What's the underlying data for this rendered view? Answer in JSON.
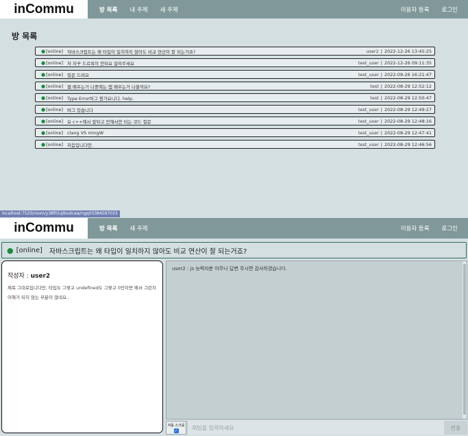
{
  "nav1": {
    "logo": "inCommu",
    "left_links": [
      "방 목록",
      "내 주제",
      "새 주제"
    ],
    "right_links": [
      "이용자 등록",
      "로그인"
    ]
  },
  "room_list": {
    "title": "방 목록",
    "rooms": [
      {
        "status": "[online]",
        "title": "자바스크립트는 왜 타입이 일치하지 않아도 비교 연산이 잘 되는거죠?",
        "author": "user2",
        "time": "2022-12-26 13:45:25"
      },
      {
        "status": "[online]",
        "title": "저 자꾸 드르륵이 안되요 알려주세요",
        "author": "test_user",
        "time": "2022-12-26 09:11:35"
      },
      {
        "status": "[online]",
        "title": "질문 드려요",
        "author": "test_user",
        "time": "2022-09-26 16:21:47"
      },
      {
        "status": "[online]",
        "title": "웹 배우는거 나중에는 앱 배우는거 나올까요?",
        "author": "test",
        "time": "2022-08-29 12:52:12"
      },
      {
        "status": "[online]",
        "title": "Type Error버그 뭔가요니다. help.",
        "author": "test",
        "time": "2022-08-29 12:50:47"
      },
      {
        "status": "[online]",
        "title": "버그 있습니다",
        "author": "test_user",
        "time": "2022-08-29 12:49:27"
      },
      {
        "status": "[online]",
        "title": "요 c++에서 앞뒤고 안해서만 되는 코드 질문",
        "author": "test_user",
        "time": "2022-08-29 12:48:16"
      },
      {
        "status": "[online]",
        "title": "clang VS mingW",
        "author": "test_user",
        "time": "2022-08-29 12:47:41"
      },
      {
        "status": "[online]",
        "title": "처음입니다만.",
        "author": "test_user",
        "time": "2022-08-29 12:46:56"
      }
    ]
  },
  "status_url": "localhost:7520/room/y38f01qlbxdcaw/ngq03384567033",
  "nav2": {
    "logo": "inCommu",
    "left_links": [
      "방 목록",
      "새 주제"
    ],
    "right_links": [
      "이용자 등록",
      "로그인"
    ]
  },
  "chat_room": {
    "status": "[online]",
    "title": "자바스크립트는 왜 타입이 일치하지 않아도 비교 연산이 잘 되는거죠?",
    "author_label": "작성자 :",
    "author": "user2",
    "body": "제목 그대로입니다만, 타입도 그렇고 undefined도 그렇고 0인이면 왜서 그런지 이해가 되지 않는 부분이 많네요..",
    "messages": [
      "user2 : js 능력자분 아무나 답변 주시면 감사하겠습니다."
    ],
    "auto_scroll_label": "자동 스크롤",
    "input_placeholder": "채팅을 입력하세요",
    "send_label": "전송"
  },
  "colors": {
    "navbar": "#809899",
    "background": "#d4dfe2",
    "online_dot": "#1e8a3e",
    "chat_panel": "#c4cfd2"
  }
}
